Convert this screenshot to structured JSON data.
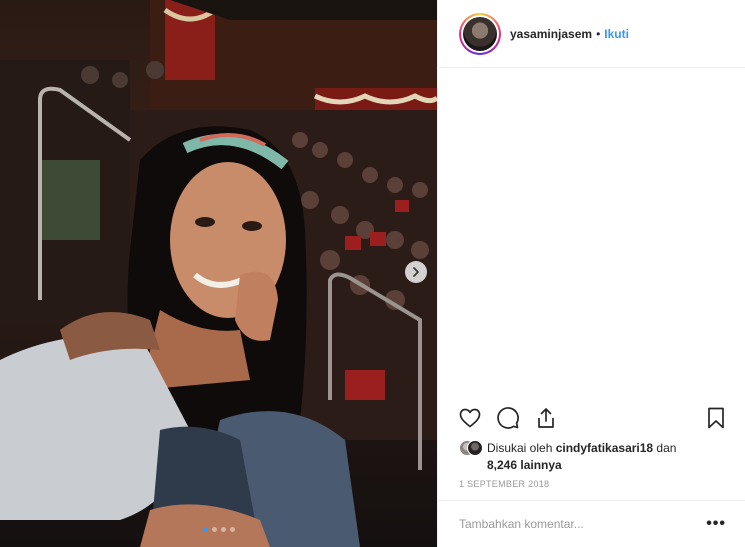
{
  "post": {
    "username": "yasaminjasem",
    "separator": "•",
    "follow_label": "Ikuti",
    "avatar_icon": "profile-avatar",
    "likes_prefix": "Disukai oleh ",
    "liked_by_user": "cindyfatikasari18",
    "likes_and": " dan",
    "likes_others": "8,246 lainnya",
    "date": "1 SEPTEMBER 2018",
    "comment_placeholder": "Tambahkan komentar...",
    "more_label": "•••"
  },
  "carousel": {
    "slide_count": 4,
    "active_index": 0,
    "next_icon": "chevron-right-icon"
  },
  "actions": [
    "heart-icon",
    "comment-icon",
    "share-icon",
    "bookmark-icon"
  ],
  "colors": {
    "link": "#3897f0",
    "text": "#262626",
    "muted": "#999999",
    "border": "#efefef"
  }
}
